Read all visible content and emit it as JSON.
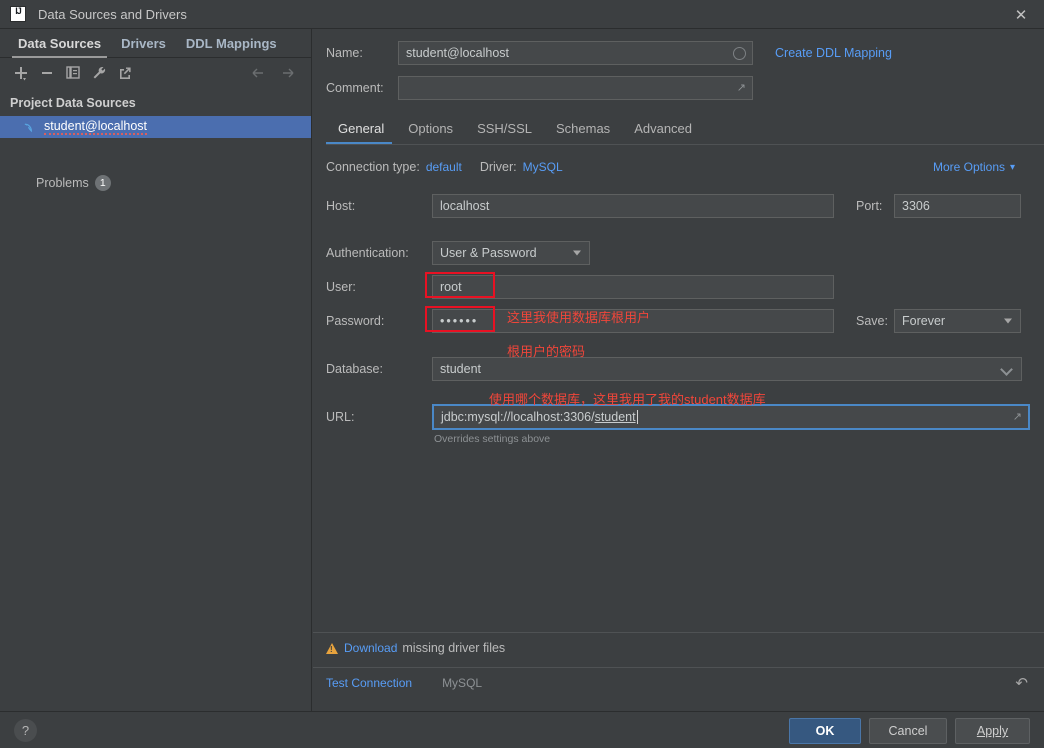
{
  "window": {
    "title": "Data Sources and Drivers",
    "app_icon": "intellij-idea-icon",
    "close_label": "✕"
  },
  "sidebar": {
    "tabs": [
      {
        "label": "Data Sources",
        "active": true
      },
      {
        "label": "Drivers",
        "active": false
      },
      {
        "label": "DDL Mappings",
        "active": false
      }
    ],
    "toolbar": [
      {
        "name": "add-icon",
        "tooltip": "Add"
      },
      {
        "name": "remove-icon",
        "tooltip": "Remove"
      },
      {
        "name": "copy-icon",
        "tooltip": "Duplicate"
      },
      {
        "name": "wrench-icon",
        "tooltip": "Properties"
      },
      {
        "name": "external-link-icon",
        "tooltip": "Open"
      },
      {
        "name": "arrow-left-icon",
        "tooltip": "Back"
      },
      {
        "name": "arrow-right-icon",
        "tooltip": "Forward"
      }
    ],
    "group_title": "Project Data Sources",
    "data_source": {
      "label": "student@localhost",
      "icon": "mysql-dolphin-icon",
      "selected": true
    },
    "problems": {
      "label": "Problems",
      "count": "1"
    }
  },
  "form": {
    "name_label": "Name:",
    "name_value": "student@localhost",
    "comment_label": "Comment:",
    "comment_value": "",
    "create_ddl_mapping": "Create DDL Mapping",
    "tabs": [
      {
        "label": "General",
        "active": true
      },
      {
        "label": "Options",
        "active": false
      },
      {
        "label": "SSH/SSL",
        "active": false
      },
      {
        "label": "Schemas",
        "active": false
      },
      {
        "label": "Advanced",
        "active": false
      }
    ],
    "connection_type_label": "Connection type:",
    "connection_type_value": "default",
    "driver_label": "Driver:",
    "driver_value": "MySQL",
    "more_options": "More Options",
    "host_label": "Host:",
    "host_value": "localhost",
    "port_label": "Port:",
    "port_value": "3306",
    "auth_label": "Authentication:",
    "auth_value": "User & Password",
    "user_label": "User:",
    "user_value": "root",
    "password_label": "Password:",
    "password_value": "••••••",
    "save_label": "Save:",
    "save_value": "Forever",
    "database_label": "Database:",
    "database_value": "student",
    "url_label": "URL:",
    "url_value": "jdbc:mysql://localhost:3306/",
    "url_value_underlined": "student",
    "url_hint": "Overrides settings above"
  },
  "annotations": {
    "color": "#f0463a",
    "box_color": "#e81123",
    "user_note": "这里我使用数据库根用户",
    "password_note": "根用户的密码",
    "database_note": "使用哪个数据库，这里我用了我的student数据库"
  },
  "status": {
    "warning_icon": "warning-triangle-icon",
    "download_link": "Download",
    "download_rest": "missing driver files",
    "test_connection": "Test Connection",
    "driver_name": "MySQL",
    "revert_icon": "revert-icon"
  },
  "footer": {
    "help_label": "?",
    "ok_label": "OK",
    "cancel_label": "Cancel",
    "apply_label": "Apply"
  }
}
